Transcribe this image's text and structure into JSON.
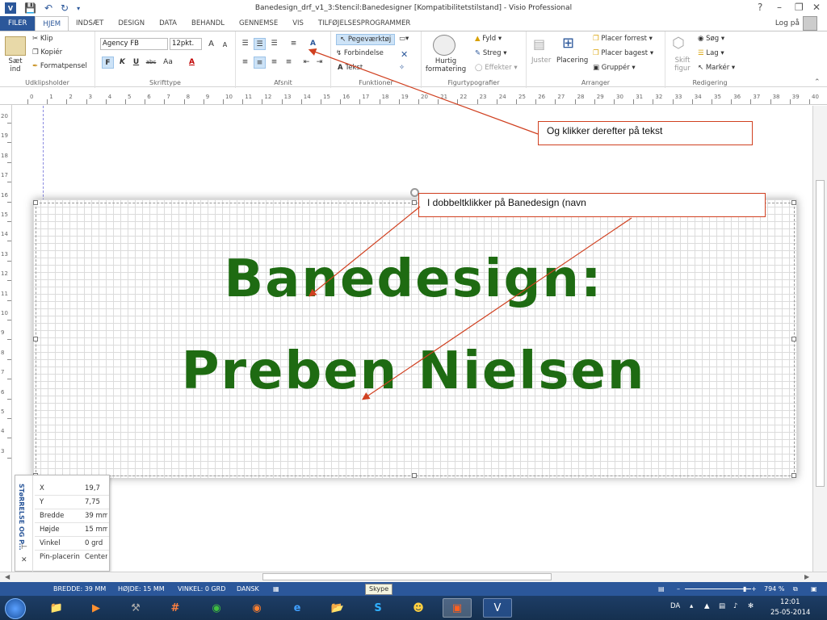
{
  "window": {
    "title": "Banedesign_drf_v1_3:Stencil:Banedesigner  [Kompatibilitetstilstand] - Visio Professional",
    "app_icon": "V",
    "help": "?",
    "login": "Log på"
  },
  "tabs": [
    "FILER",
    "HJEM",
    "INDSÆT",
    "DESIGN",
    "DATA",
    "BEHANDL",
    "GENNEMSE",
    "VIS",
    "TILFØJELSESPROGRAMMER"
  ],
  "ribbon": {
    "clipboard": {
      "label": "Udklipsholder",
      "paste": "Sæt ind",
      "cut": "Klip",
      "copy": "Kopiér",
      "format_painter": "Formatpensel"
    },
    "font": {
      "label": "Skrifttype",
      "font_name": "Agency FB",
      "font_size": "12pkt.",
      "grow": "A",
      "shrink": "A",
      "bold": "F",
      "italic": "K",
      "underline": "U",
      "strike": "abc",
      "case": "Aa",
      "color": "A"
    },
    "paragraph": {
      "label": "Afsnit"
    },
    "tools": {
      "label": "Funktioner",
      "pointer": "Pegeværktøj",
      "connector": "Forbindelse",
      "text": "Tekst"
    },
    "shape_styles": {
      "label": "Figurtypografier",
      "quick": "Hurtig formatering",
      "fill": "Fyld",
      "line": "Streg",
      "effects": "Effekter"
    },
    "arrange": {
      "label": "Arranger",
      "align": "Juster",
      "position": "Placering",
      "front": "Placer forrest",
      "back": "Placer bagest",
      "group": "Gruppér"
    },
    "editing": {
      "label": "Redigering",
      "change_shape": "Skift figur",
      "find": "Søg",
      "layers": "Lag",
      "select": "Markér"
    }
  },
  "ruler": {
    "h_labels": [
      "0",
      "1",
      "2",
      "3",
      "4",
      "5",
      "6",
      "7",
      "8",
      "9",
      "10",
      "11",
      "12",
      "13",
      "14",
      "15",
      "16",
      "17",
      "18",
      "19",
      "20",
      "21",
      "22",
      "23",
      "24",
      "25",
      "26",
      "27",
      "28",
      "29",
      "30",
      "31",
      "32",
      "33",
      "34",
      "35",
      "36",
      "37",
      "38",
      "39",
      "40"
    ],
    "v_labels": [
      "20",
      "19",
      "18",
      "17",
      "16",
      "15",
      "14",
      "13",
      "12",
      "11",
      "10",
      "9",
      "8",
      "7",
      "6",
      "5",
      "4",
      "3"
    ]
  },
  "drawing": {
    "line1": "Banedesign:",
    "line2": "Preben Nielsen"
  },
  "callouts": {
    "c1": "Og klikker derefter på tekst",
    "c2": "I dobbeltklikker på Banedesign (navn"
  },
  "size_panel": {
    "title": "STøRRELSE OG P...",
    "rows": [
      {
        "k": "X",
        "v": "19,7"
      },
      {
        "k": "Y",
        "v": "7,75"
      },
      {
        "k": "Bredde",
        "v": "39 mm"
      },
      {
        "k": "Højde",
        "v": "15 mm"
      },
      {
        "k": "Vinkel",
        "v": "0 grd"
      },
      {
        "k": "Pin-placerin",
        "v": "Center"
      }
    ]
  },
  "statusbar": {
    "width": "BREDDE: 39 MM",
    "height": "HØJDE: 15 MM",
    "angle": "VINKEL: 0 GRD",
    "language": "DANSK",
    "tooltip": "Skype",
    "zoom": "794 %"
  },
  "tray": {
    "lang": "DA",
    "time": "12:01",
    "date": "25-05-2014"
  },
  "colors": {
    "accent": "#2b579a",
    "text_green": "#1e6b12",
    "callout_border": "#d04020"
  }
}
